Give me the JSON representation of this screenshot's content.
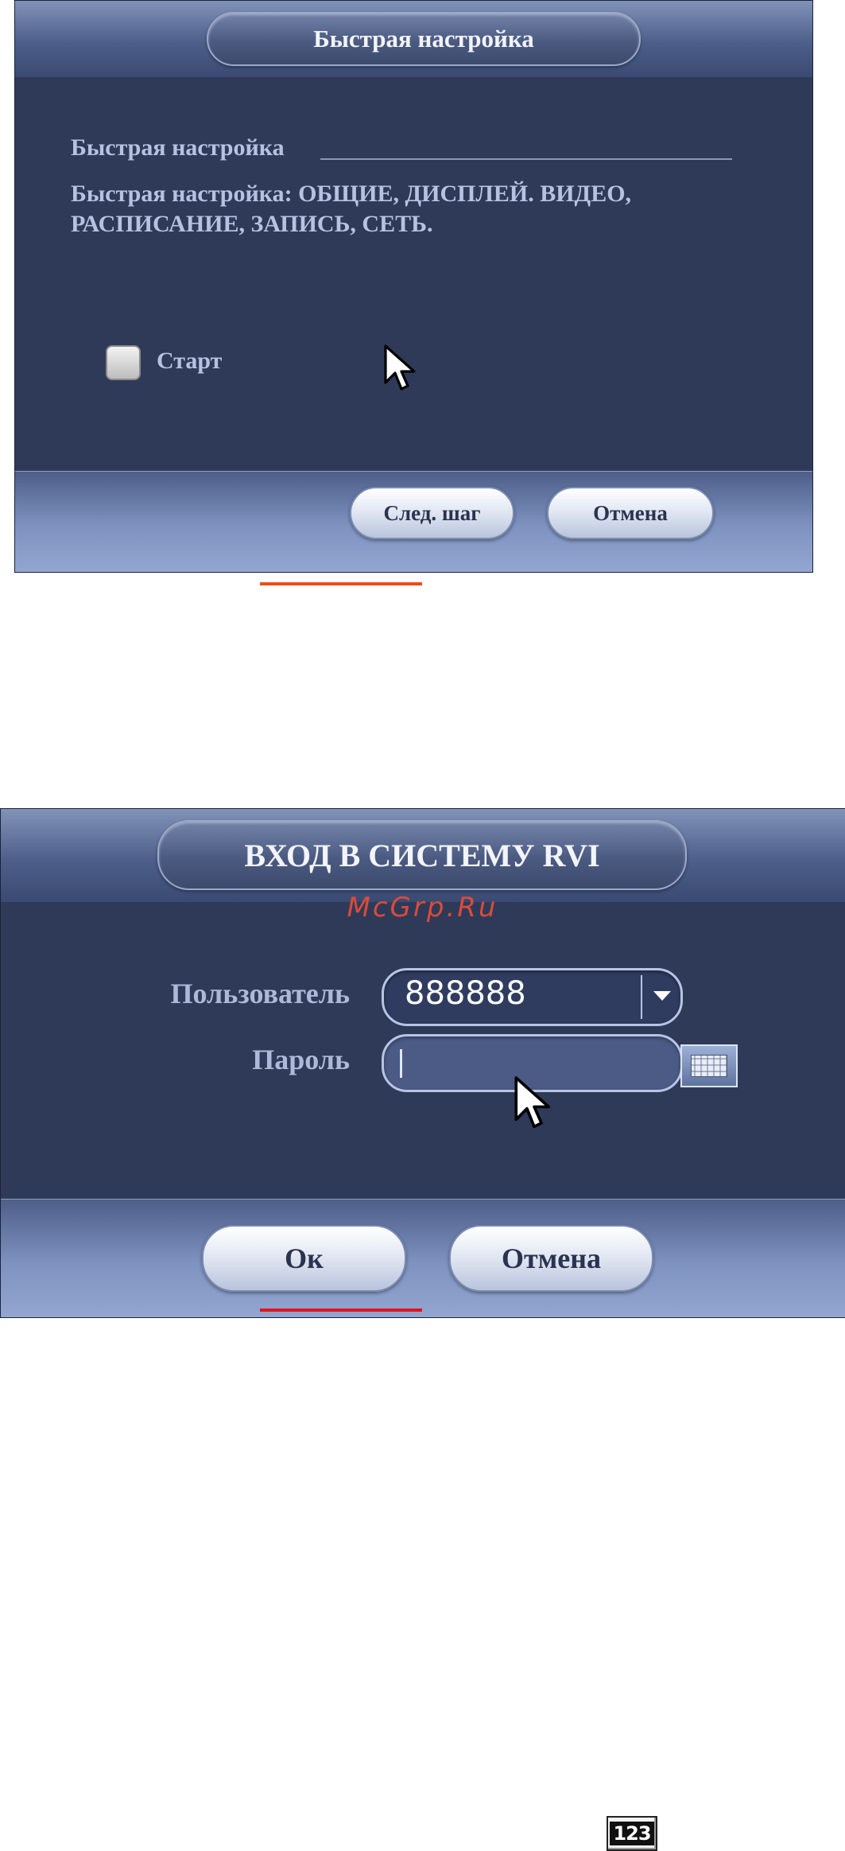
{
  "quick_setup": {
    "title": "Быстрая настройка",
    "section_label": "Быстрая настройка",
    "description": "Быстрая настройка: ОБЩИЕ, ДИСПЛЕЙ. ВИДЕО, РАСПИСАНИЕ, ЗАПИСЬ, СЕТЬ.",
    "start_checkbox": {
      "label": "Старт",
      "checked": false
    },
    "next_button": "След. шаг",
    "cancel_button": "Отмена"
  },
  "login": {
    "title": "ВХОД В СИСТЕМУ RVI",
    "watermark": "McGrp.Ru",
    "user_label": "Пользователь",
    "user_value": "888888",
    "password_label": "Пароль",
    "password_value": "",
    "ok_button": "Ок",
    "cancel_button": "Отмена"
  },
  "footer_icon": {
    "text": "123",
    "icon": "numeric-keyboard-icon"
  },
  "colors": {
    "dialog_bg": "#2f3a58",
    "label_text": "#b7c2e3",
    "orange_rule": "#f04c18",
    "red_rule": "#e0151d"
  }
}
